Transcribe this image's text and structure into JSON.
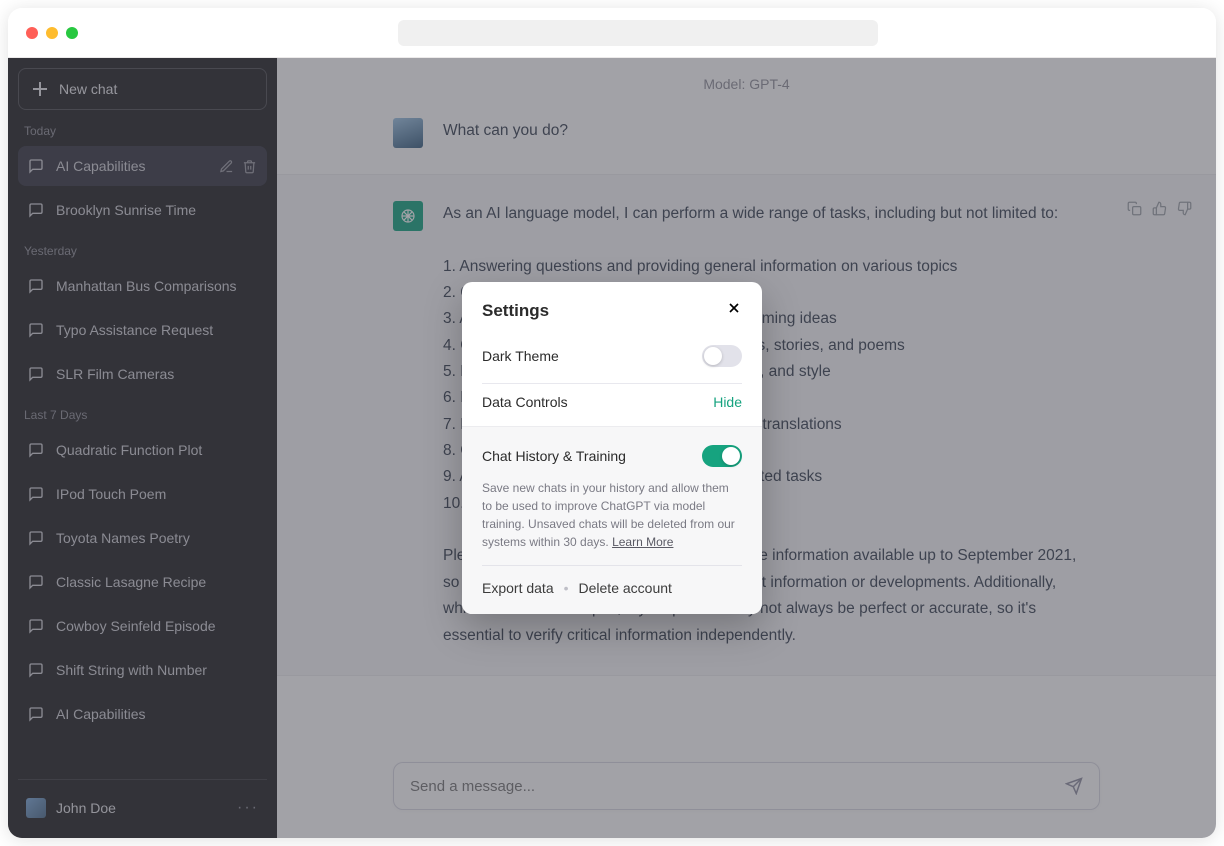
{
  "sidebar": {
    "new_chat_label": "New chat",
    "sections": {
      "today": "Today",
      "yesterday": "Yesterday",
      "last7": "Last 7 Days"
    },
    "today": [
      "AI Capabilities",
      "Brooklyn Sunrise Time"
    ],
    "yesterday": [
      "Manhattan Bus Comparisons",
      "Typo Assistance Request",
      "SLR Film Cameras"
    ],
    "last7": [
      "Quadratic Function Plot",
      "IPod Touch Poem",
      "Toyota Names Poetry",
      "Classic Lasagne Recipe",
      "Cowboy Seinfeld Episode",
      "Shift String with Number",
      "AI Capabilities"
    ],
    "active_title": "AI Capabilities",
    "user_name": "John Doe"
  },
  "chat": {
    "model_label": "Model: GPT-4",
    "user_message": "What can you do?",
    "assistant_intro": "As an AI language model, I can perform a wide range of tasks, including but not limited to:",
    "assistant_list": [
      "1. Answering questions and providing general information on various topics",
      "2. Offering explanations and clarifications",
      "3. Assisting with problem-solving and brainstorming ideas",
      "4. Generating creative content, such as essays, stories, and poems",
      "5. Helping with grammar, spelling, punctuation, and style",
      "6. Providing summaries of text",
      "7. Helping with language learning and offering translations",
      "8. Giving recommendations and suggestions",
      "9. Assisting with coding and programming-related tasks",
      "10. Engaging in casual conversation"
    ],
    "assistant_outro": "Please note that my knowledge is based on the information available up to September 2021, so I may not be able to provide the most recent information or developments. Additionally, while I strive to be helpful, my responses may not always be perfect or accurate, so it's essential to verify critical information independently.",
    "composer_placeholder": "Send a message..."
  },
  "settings": {
    "title": "Settings",
    "dark_theme_label": "Dark Theme",
    "dark_theme_on": false,
    "data_controls_label": "Data Controls",
    "data_controls_action": "Hide",
    "chat_history_label": "Chat History & Training",
    "chat_history_on": true,
    "chat_history_desc_prefix": "Save new chats in your history and allow them to be used to improve ChatGPT via model training. Unsaved chats will be deleted from our systems within 30 days. ",
    "learn_more": "Learn More",
    "export_label": "Export data",
    "delete_label": "Delete account"
  }
}
